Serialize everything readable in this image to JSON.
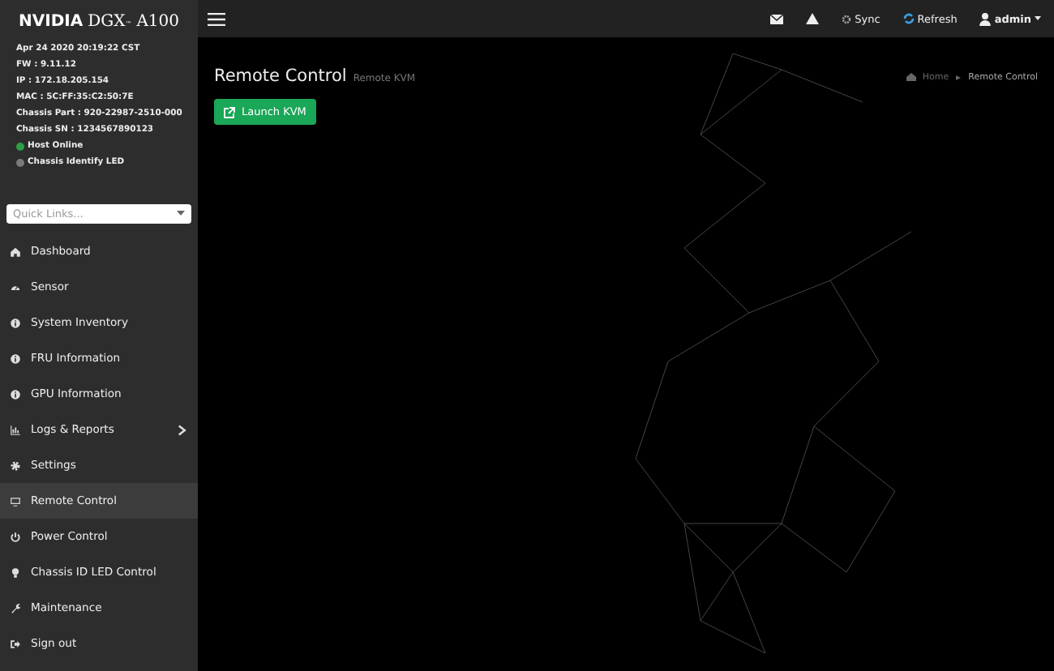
{
  "brand": {
    "name": "NVIDIA",
    "product": "DGX",
    "mark": "™",
    "model": "A100"
  },
  "system_info": [
    "Apr 24 2020 20:19:22 CST",
    "FW : 9.11.12",
    "IP : 172.18.205.154",
    "MAC : 5C:FF:35:C2:50:7E",
    "Chassis Part : 920-22987-2510-000",
    "Chassis SN : 1234567890123"
  ],
  "status": [
    {
      "label": "Host Online",
      "color": "#2e9e45"
    },
    {
      "label": "Chassis Identify LED",
      "color": "#7a7a7a"
    }
  ],
  "quick_links": {
    "placeholder": "Quick Links..."
  },
  "sidebar": {
    "items": [
      {
        "label": "Dashboard",
        "selected": false,
        "expandable": false
      },
      {
        "label": "Sensor",
        "selected": false,
        "expandable": false
      },
      {
        "label": "System Inventory",
        "selected": false,
        "expandable": false
      },
      {
        "label": "FRU Information",
        "selected": false,
        "expandable": false
      },
      {
        "label": "GPU Information",
        "selected": false,
        "expandable": false
      },
      {
        "label": "Logs & Reports",
        "selected": false,
        "expandable": true
      },
      {
        "label": "Settings",
        "selected": false,
        "expandable": false
      },
      {
        "label": "Remote Control",
        "selected": true,
        "expandable": false
      },
      {
        "label": "Power Control",
        "selected": false,
        "expandable": false
      },
      {
        "label": "Chassis ID LED Control",
        "selected": false,
        "expandable": false
      },
      {
        "label": "Maintenance",
        "selected": false,
        "expandable": false
      },
      {
        "label": "Sign out",
        "selected": false,
        "expandable": false
      }
    ]
  },
  "top_bar": {
    "sync": "Sync",
    "refresh": "Refresh",
    "user": "admin"
  },
  "page": {
    "title": "Remote Control",
    "subtitle": "Remote KVM",
    "breadcrumb": [
      "Home",
      "Remote Control"
    ],
    "launch_button": "Launch KVM"
  }
}
